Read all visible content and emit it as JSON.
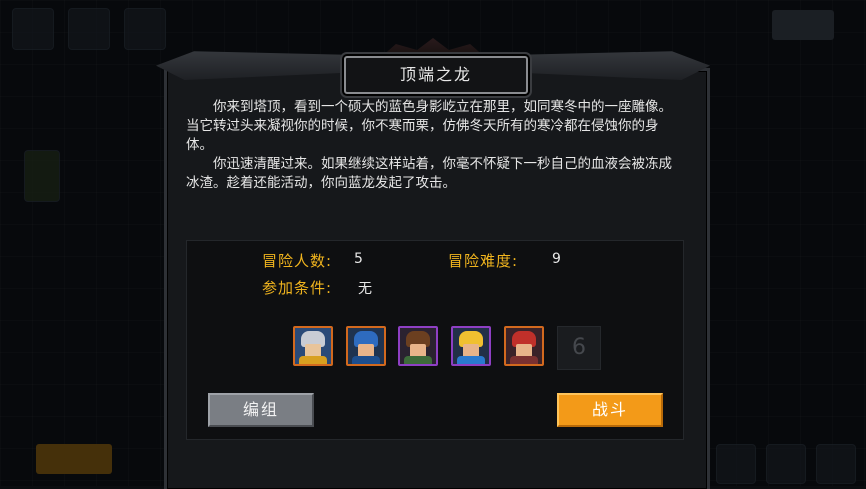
{
  "dialog": {
    "title": "顶端之龙",
    "story": [
      "你来到塔顶，看到一个硕大的蓝色身影屹立在那里，如同寒冬中的一座雕像。当它转过头来凝视你的时候，你不寒而栗，仿佛冬天所有的寒冷都在侵蚀你的身体。",
      "你迅速清醒过来。如果继续这样站着，你毫不怀疑下一秒自己的血液会被冻成冰渣。趁着还能活动，你向蓝龙发起了攻击。"
    ],
    "info": {
      "party_size_label": "冒险人数:",
      "party_size_value": "5",
      "difficulty_label": "冒险难度:",
      "difficulty_value": "9",
      "requirement_label": "参加条件:",
      "requirement_value": "无"
    },
    "heroes": [
      {
        "icon": "armored-knight-portrait",
        "frame": "#d2691e"
      },
      {
        "icon": "blue-helmet-warrior-portrait",
        "frame": "#d2691e"
      },
      {
        "icon": "brown-hair-rogue-portrait",
        "frame": "#8e3fc4"
      },
      {
        "icon": "blonde-hero-portrait",
        "frame": "#8e3fc4"
      },
      {
        "icon": "red-hair-goggles-portrait",
        "frame": "#d2691e"
      }
    ],
    "empty_slot": "6",
    "buttons": {
      "edit_team": "编组",
      "battle": "战斗"
    }
  },
  "colors": {
    "label": "#f0b41e",
    "battle_button": "#f39a18",
    "edit_button": "#7a7e84"
  }
}
